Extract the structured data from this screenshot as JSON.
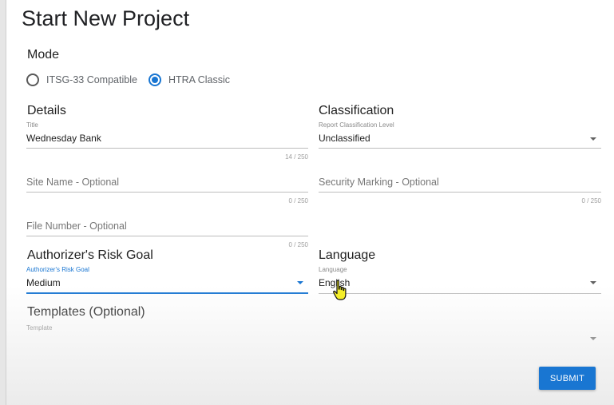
{
  "page": {
    "title": "Start New Project"
  },
  "mode": {
    "heading": "Mode",
    "options": [
      {
        "label": "ITSG-33 Compatible",
        "selected": false
      },
      {
        "label": "HTRA Classic",
        "selected": true
      }
    ]
  },
  "details": {
    "heading": "Details",
    "title_field": {
      "label": "Title",
      "value": "Wednesday Bank",
      "counter": "14 / 250"
    },
    "site_name": {
      "placeholder": "Site Name - Optional",
      "counter": "0 / 250"
    },
    "file_number": {
      "placeholder": "File Number - Optional",
      "counter": "0 / 250"
    }
  },
  "classification": {
    "heading": "Classification",
    "level_field": {
      "label": "Report Classification Level",
      "value": "Unclassified"
    },
    "security_marking": {
      "placeholder": "Security Marking - Optional",
      "counter": "0 / 250"
    }
  },
  "risk_goal": {
    "heading": "Authorizer's Risk Goal",
    "field": {
      "label": "Authorizer's Risk Goal",
      "value": "Medium"
    }
  },
  "language": {
    "heading": "Language",
    "field": {
      "label": "Language",
      "value": "English"
    }
  },
  "templates": {
    "heading": "Templates (Optional)",
    "field": {
      "label": "Template",
      "value": ""
    }
  },
  "actions": {
    "submit_label": "SUBMIT"
  },
  "colors": {
    "accent": "#1976d2"
  },
  "cursor": {
    "icon": "hand-pointer-icon"
  }
}
